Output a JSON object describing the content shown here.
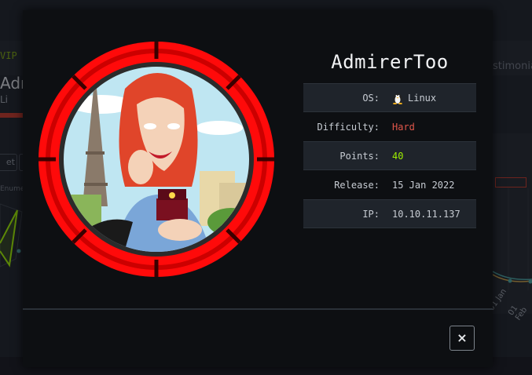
{
  "background": {
    "vip_label": "VIP",
    "nav_right": "stimonia",
    "machine_title_fragment": "Adm",
    "os_fragment": "Li",
    "chip_label": "et",
    "radar_label": "Enumer",
    "axis_dates": [
      "01 Jan",
      "01 Feb"
    ]
  },
  "modal": {
    "title": "AdmirerToo",
    "info": [
      {
        "label": "OS:",
        "value": "Linux",
        "icon": "tux-icon"
      },
      {
        "label": "Difficulty:",
        "value": "Hard"
      },
      {
        "label": "Points:",
        "value": "40"
      },
      {
        "label": "Release:",
        "value": "15 Jan 2022"
      },
      {
        "label": "IP:",
        "value": "10.10.11.137"
      }
    ],
    "close_label": "×"
  },
  "colors": {
    "accent_green": "#9fef00",
    "difficulty_hard": "#e0564a",
    "avatar_ring": "#ff0000"
  }
}
